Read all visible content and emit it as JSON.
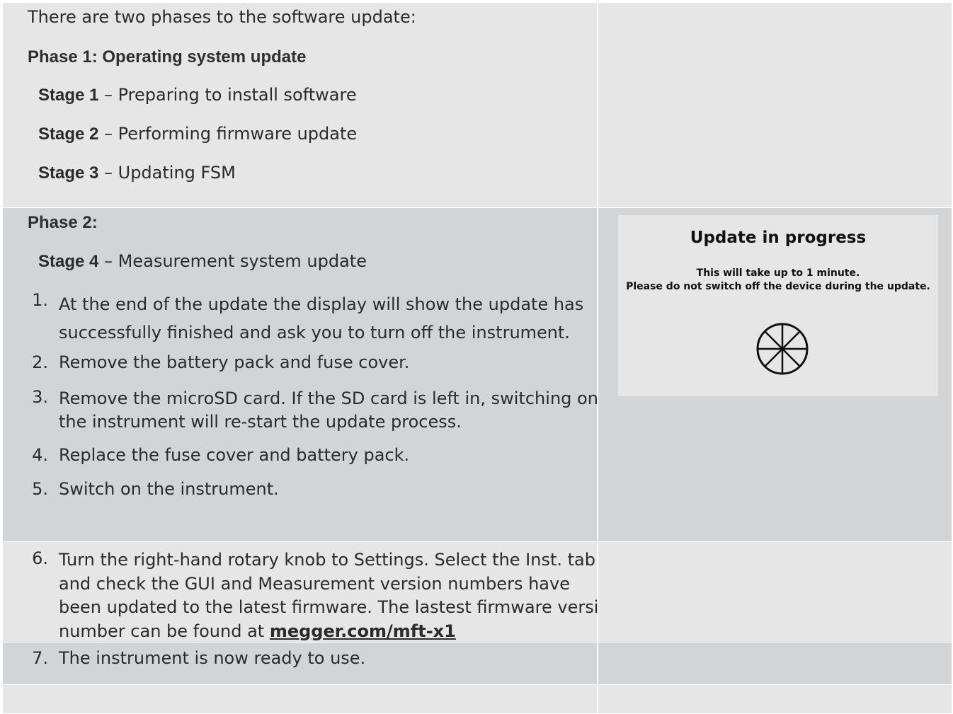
{
  "intro": "There are two phases to the software update:",
  "phase1": {
    "heading": "Phase 1: Operating system update",
    "stages": [
      {
        "label": "Stage 1",
        "text": " – Preparing to install software"
      },
      {
        "label": "Stage 2",
        "text": " – Performing firmware update"
      },
      {
        "label": "Stage 3",
        "text": " – Updating FSM"
      }
    ]
  },
  "phase2": {
    "heading": "Phase 2:",
    "stage": {
      "label": "Stage 4",
      "text": " – Measurement system update"
    },
    "steps": [
      {
        "num": "1.",
        "lines": [
          "At the end of the update the display will show the update has",
          "successfully finished and ask you to turn off the instrument."
        ]
      },
      {
        "num": "2.",
        "lines": [
          "Remove the battery pack and fuse cover."
        ]
      },
      {
        "num": "3.",
        "lines": [
          "Remove the microSD card. If the SD card is left in, switching on",
          "the instrument will re-start the update process."
        ]
      },
      {
        "num": "4.",
        "lines": [
          "Replace the fuse cover and battery pack."
        ]
      },
      {
        "num": "5.",
        "lines": [
          "Switch on the instrument."
        ]
      }
    ]
  },
  "step6": {
    "num": "6.",
    "lines": [
      "Turn the right-hand rotary knob to Settings. Select the Inst. tab",
      "and check the GUI and Measurement version numbers have",
      "been updated to the latest firmware. The lastest firmware version"
    ],
    "last_prefix": "number can be found at ",
    "link": "megger.com/mft-x1"
  },
  "step7": {
    "num": "7.",
    "text": "The instrument is now ready to use."
  },
  "screen": {
    "title": "Update in progress",
    "line1": "This will take up to 1 minute.",
    "line2": "Please do not switch off the device during the update.",
    "icon": "progress-wheel-icon"
  },
  "colors": {
    "light": "#e6e6e7",
    "dark": "#d3d4d6"
  }
}
